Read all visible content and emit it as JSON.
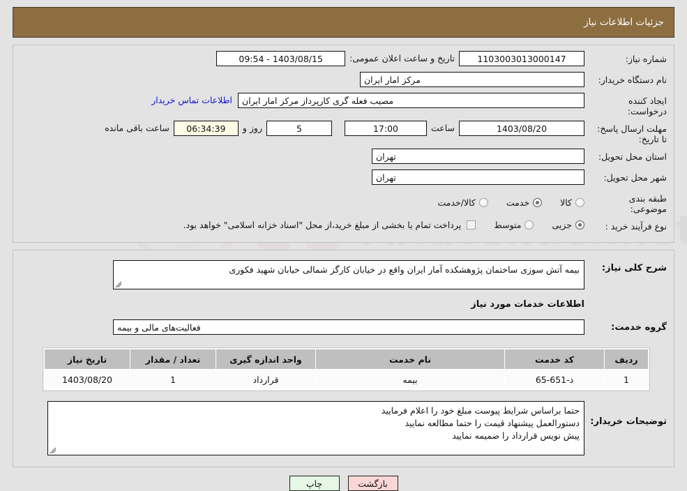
{
  "header": {
    "title": "جزئیات اطلاعات نیاز"
  },
  "colors": {
    "header_bg": "#8d6e41",
    "page_bg": "#e3e3e3",
    "link": "#1515d0",
    "countdown_bg": "#fbfbe6",
    "table_header_bg": "#bfbfbf",
    "print_btn_bg": "#e6f7e6",
    "back_btn_bg": "#fbd6d6"
  },
  "top": {
    "need_number_label": "شماره نیاز:",
    "need_number_value": "1103003013000147",
    "public_announce_label": "تاریخ و ساعت اعلان عمومی:",
    "public_announce_value": "1403/08/15 - 09:54",
    "buyer_org_label": "نام دستگاه خریدار:",
    "buyer_org_value": "مرکز امار ایران",
    "creator_label": "ایجاد کننده درخواست:",
    "creator_value": "مصیب فعله گری کارپرداز مرکز امار ایران",
    "contact_link": "اطلاعات تماس خریدار",
    "deadline_label": "مهلت ارسال پاسخ: تا تاریخ:",
    "deadline_date": "1403/08/20",
    "hour_label": "ساعت",
    "hour_value": "17:00",
    "days_value": "5",
    "days_label": "روز و",
    "countdown_value": "06:34:39",
    "countdown_label": "ساعت باقی مانده",
    "province_label": "استان محل تحویل:",
    "province_value": "تهران",
    "city_label": "شهر محل تحویل:",
    "city_value": "تهران",
    "category_label": "طبقه بندی موضوعی:",
    "category_options": [
      {
        "label": "کالا",
        "selected": false
      },
      {
        "label": "خدمت",
        "selected": true
      },
      {
        "label": "کالا/خدمت",
        "selected": false
      }
    ],
    "process_label": "نوع فرآیند خرید :",
    "process_options": [
      {
        "label": "جزیی",
        "selected": true
      },
      {
        "label": "متوسط",
        "selected": false
      }
    ],
    "treasury_checkbox_checked": false,
    "treasury_note": "پرداخت تمام یا بخشی از مبلغ خرید،از محل \"اسناد خزانه اسلامی\" خواهد بود."
  },
  "bottom": {
    "need_desc_label": "شرح کلی نیاز:",
    "need_desc_value": "بیمه آتش سوزی ساختمان پژوهشکده آمار ایران واقع در خیابان کارگز شمالی خیابان شهید فکوری",
    "services_section_title": "اطلاعات خدمات مورد نیاز",
    "service_group_label": "گروه خدمت:",
    "service_group_value": "فعالیت‌های مالی و بیمه",
    "table": {
      "headers": [
        "ردیف",
        "کد خدمت",
        "نام خدمت",
        "واحد اندازه گیری",
        "تعداد / مقدار",
        "تاریخ نیاز"
      ],
      "rows": [
        [
          "1",
          "ذ-651-65",
          "بیمه",
          "قرارداد",
          "1",
          "1403/08/20"
        ]
      ]
    },
    "buyer_notes_label": "توضیحات خریدار:",
    "buyer_notes_lines": [
      "حتما براساس شرایط پیوست  مبلغ خود را اعلام فرمایید",
      "دستورالعمل پیشنهاد قیمت را حتما مطالعه نمایید",
      "پیش نویس قرارداد را ضمیمه نمایید"
    ]
  },
  "footer": {
    "print_label": "چاپ",
    "back_label": "بازگشت"
  },
  "watermark": {
    "text": "AriaTender.net"
  }
}
